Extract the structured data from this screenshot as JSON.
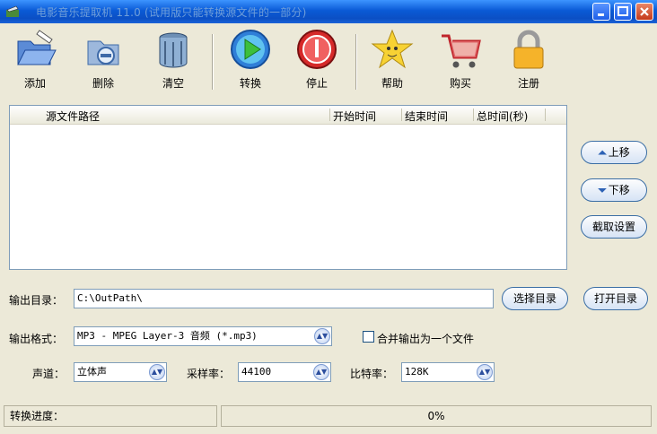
{
  "window": {
    "title": "电影音乐提取机 11.0 (试用版只能转换源文件的一部分)"
  },
  "toolbar": {
    "add": "添加",
    "delete": "删除",
    "clear": "清空",
    "convert": "转换",
    "stop": "停止",
    "help": "帮助",
    "buy": "购买",
    "register": "注册"
  },
  "file_list": {
    "columns": [
      "源文件路径",
      "开始时间",
      "结束时间",
      "总时间(秒)"
    ],
    "rows": []
  },
  "side_buttons": {
    "up": "上移",
    "down": "下移",
    "crop_settings": "截取设置"
  },
  "output": {
    "dir_label": "输出目录：",
    "dir_value": "C:\\OutPath\\",
    "choose_dir": "选择目录",
    "open_dir": "打开目录",
    "format_label": "输出格式：",
    "format_value": "MP3 - MPEG Layer-3 音频 (*.mp3)",
    "merge_label": "合并输出为一个文件",
    "merge_checked": false,
    "channel_label": "声道：",
    "channel_value": "立体声",
    "sample_label": "采样率：",
    "sample_value": "44100",
    "bitrate_label": "比特率：",
    "bitrate_value": "128K"
  },
  "status": {
    "progress_label": "转换进度：",
    "progress_text": "0%",
    "progress": 0
  },
  "icons": {
    "up": "double-chevron-up-icon",
    "down": "double-chevron-down-icon",
    "combo": "combo-arrow-icon"
  },
  "colors": {
    "titlebar": "#0a5ad6",
    "face": "#ece9d8",
    "border": "#7f9db9"
  }
}
